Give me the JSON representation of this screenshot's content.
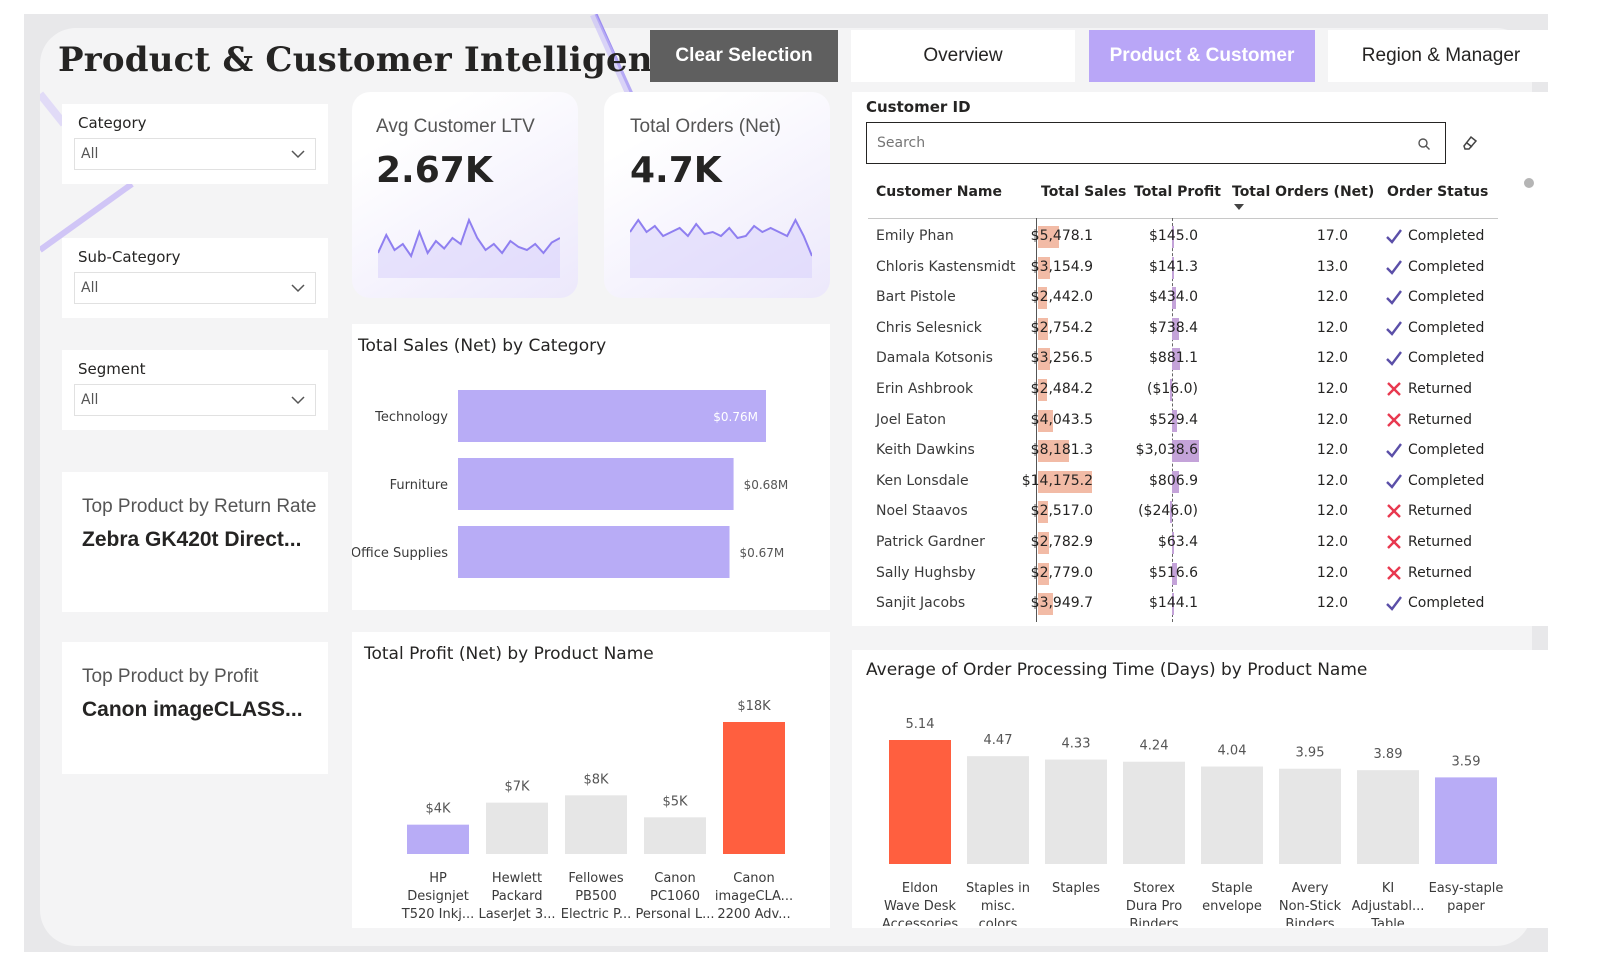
{
  "page_title": "Product & Customer Intelligence",
  "nav": {
    "clear_selection": "Clear Selection",
    "overview": "Overview",
    "product_customer": "Product & Customer",
    "region_manager": "Region & Manager",
    "active": "Product & Customer"
  },
  "colors": {
    "accent_purple": "#b9a6f7",
    "bar_purple": "#b8acf6",
    "highlight_orange": "#ff5f3f",
    "neutral_bar": "#e6e6e6",
    "sales_databar": "#f2bba6",
    "profit_databar": "#c4a3d9",
    "returned_red": "#e8384f",
    "completed_check": "#5b4fa8"
  },
  "slicers": {
    "category": {
      "label": "Category",
      "value": "All"
    },
    "sub_category": {
      "label": "Sub-Category",
      "value": "All"
    },
    "segment": {
      "label": "Segment",
      "value": "All"
    }
  },
  "kpis": {
    "avg_ltv": {
      "label": "Avg Customer LTV",
      "value": "2.67K"
    },
    "total_orders": {
      "label": "Total Orders (Net)",
      "value": "4.7K"
    }
  },
  "top_products": {
    "return_rate": {
      "label": "Top Product by Return Rate",
      "value": "Zebra GK420t Direct..."
    },
    "profit": {
      "label": "Top Product by Profit",
      "value": "Canon imageCLASS..."
    }
  },
  "customer_table": {
    "slicer_label": "Customer ID",
    "search_placeholder": "Search",
    "headers": [
      "Customer Name",
      "Total Sales",
      "Total Profit",
      "Total Orders (Net)",
      "Order Status"
    ],
    "rows": [
      {
        "name": "Emily Phan",
        "sales": "$5,478.1",
        "sales_v": 5478.1,
        "profit": "$145.0",
        "profit_v": 145.0,
        "orders": "17.0",
        "status": "Completed"
      },
      {
        "name": "Chloris Kastensmidt",
        "sales": "$3,154.9",
        "sales_v": 3154.9,
        "profit": "$141.3",
        "profit_v": 141.3,
        "orders": "13.0",
        "status": "Completed"
      },
      {
        "name": "Bart Pistole",
        "sales": "$2,442.0",
        "sales_v": 2442.0,
        "profit": "$434.0",
        "profit_v": 434.0,
        "orders": "12.0",
        "status": "Completed"
      },
      {
        "name": "Chris Selesnick",
        "sales": "$2,754.2",
        "sales_v": 2754.2,
        "profit": "$738.4",
        "profit_v": 738.4,
        "orders": "12.0",
        "status": "Completed"
      },
      {
        "name": "Damala Kotsonis",
        "sales": "$3,256.5",
        "sales_v": 3256.5,
        "profit": "$881.1",
        "profit_v": 881.1,
        "orders": "12.0",
        "status": "Completed"
      },
      {
        "name": "Erin Ashbrook",
        "sales": "$2,484.2",
        "sales_v": 2484.2,
        "profit": "($16.0)",
        "profit_v": -16.0,
        "orders": "12.0",
        "status": "Returned"
      },
      {
        "name": "Joel Eaton",
        "sales": "$4,043.5",
        "sales_v": 4043.5,
        "profit": "$529.4",
        "profit_v": 529.4,
        "orders": "12.0",
        "status": "Returned"
      },
      {
        "name": "Keith Dawkins",
        "sales": "$8,181.3",
        "sales_v": 8181.3,
        "profit": "$3,038.6",
        "profit_v": 3038.6,
        "orders": "12.0",
        "status": "Completed"
      },
      {
        "name": "Ken Lonsdale",
        "sales": "$14,175.2",
        "sales_v": 14175.2,
        "profit": "$806.9",
        "profit_v": 806.9,
        "orders": "12.0",
        "status": "Completed"
      },
      {
        "name": "Noel Staavos",
        "sales": "$2,517.0",
        "sales_v": 2517.0,
        "profit": "($246.0)",
        "profit_v": -246.0,
        "orders": "12.0",
        "status": "Returned"
      },
      {
        "name": "Patrick Gardner",
        "sales": "$2,782.9",
        "sales_v": 2782.9,
        "profit": "$63.4",
        "profit_v": 63.4,
        "orders": "12.0",
        "status": "Returned"
      },
      {
        "name": "Sally Hughsby",
        "sales": "$2,779.0",
        "sales_v": 2779.0,
        "profit": "$516.6",
        "profit_v": 516.6,
        "orders": "12.0",
        "status": "Returned"
      },
      {
        "name": "Sanjit Jacobs",
        "sales": "$3,949.7",
        "sales_v": 3949.7,
        "profit": "$144.1",
        "profit_v": 144.1,
        "orders": "12.0",
        "status": "Completed"
      }
    ]
  },
  "chart_data": [
    {
      "id": "sales_by_category",
      "type": "bar",
      "orientation": "horizontal",
      "title": "Total Sales (Net) by Category",
      "categories": [
        "Technology",
        "Furniture",
        "Office Supplies"
      ],
      "values": [
        0.76,
        0.68,
        0.67
      ],
      "data_labels": [
        "$0.76M",
        "$0.68M",
        "$0.67M"
      ],
      "unit": "$M"
    },
    {
      "id": "profit_by_product",
      "type": "bar",
      "title": "Total Profit (Net) by Product Name",
      "categories": [
        "HP Designjet T520 Inkj...",
        "Hewlett Packard LaserJet 3...",
        "Fellowes PB500 Electric P...",
        "Canon PC1060 Personal L...",
        "Canon imageCLA... 2200 Adv..."
      ],
      "category_lines": [
        [
          "HP",
          "Designjet",
          "T520 Inkj..."
        ],
        [
          "Hewlett",
          "Packard",
          "LaserJet 3..."
        ],
        [
          "Fellowes",
          "PB500",
          "Electric P..."
        ],
        [
          "Canon",
          "PC1060",
          "Personal L..."
        ],
        [
          "Canon",
          "imageCLA...",
          "2200 Adv..."
        ]
      ],
      "values": [
        4,
        7,
        8,
        5,
        18
      ],
      "data_labels": [
        "$4K",
        "$7K",
        "$8K",
        "$5K",
        "$18K"
      ],
      "bar_colors": [
        "#b8acf6",
        "#e6e6e6",
        "#e6e6e6",
        "#e6e6e6",
        "#ff5f3f"
      ],
      "unit": "$K"
    },
    {
      "id": "processing_time_by_product",
      "type": "bar",
      "title": "Average of Order Processing Time (Days) by Product Name",
      "categories": [
        "Eldon Wave Desk Accessories",
        "Staples in misc. colors",
        "Staples",
        "Storex Dura Pro Binders",
        "Staple envelope",
        "Avery Non-Stick Binders",
        "KI Adjustabl... Table",
        "Easy-staple paper"
      ],
      "category_lines": [
        [
          "Eldon",
          "Wave Desk",
          "Accessories"
        ],
        [
          "Staples in",
          "misc.",
          "colors"
        ],
        [
          "Staples"
        ],
        [
          "Storex",
          "Dura Pro",
          "Binders"
        ],
        [
          "Staple",
          "envelope"
        ],
        [
          "Avery",
          "Non-Stick",
          "Binders"
        ],
        [
          "KI",
          "Adjustabl...",
          "Table"
        ],
        [
          "Easy-staple",
          "paper"
        ]
      ],
      "values": [
        5.14,
        4.47,
        4.33,
        4.24,
        4.04,
        3.95,
        3.89,
        3.59
      ],
      "data_labels": [
        "5.14",
        "4.47",
        "4.33",
        "4.24",
        "4.04",
        "3.95",
        "3.89",
        "3.59"
      ],
      "bar_colors": [
        "#ff5f3f",
        "#e6e6e6",
        "#e6e6e6",
        "#e6e6e6",
        "#e6e6e6",
        "#e6e6e6",
        "#e6e6e6",
        "#b8acf6"
      ]
    }
  ],
  "sparklines": {
    "avg_ltv": [
      2.6,
      2.72,
      2.62,
      2.66,
      2.58,
      2.74,
      2.6,
      2.68,
      2.63,
      2.7,
      2.66,
      2.82,
      2.7,
      2.62,
      2.66,
      2.6,
      2.68,
      2.64,
      2.62,
      2.66,
      2.6,
      2.67,
      2.7
    ],
    "total_orders": [
      4.72,
      4.78,
      4.72,
      4.75,
      4.7,
      4.72,
      4.74,
      4.7,
      4.76,
      4.71,
      4.72,
      4.7,
      4.74,
      4.69,
      4.7,
      4.75,
      4.72,
      4.74,
      4.72,
      4.7,
      4.78,
      4.7,
      4.6
    ]
  }
}
